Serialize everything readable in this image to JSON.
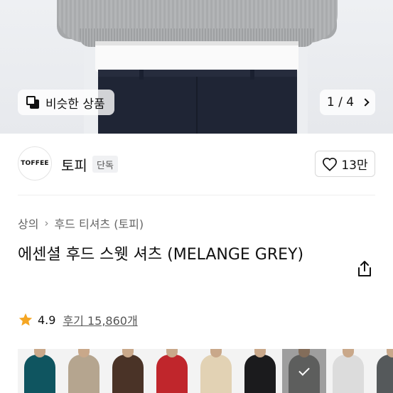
{
  "gallery": {
    "similar_label": "비슷한 상품",
    "page_current": "1",
    "page_sep": "/",
    "page_total": "4"
  },
  "brand": {
    "logo_text": "TOFFEE",
    "name": "토피",
    "badge": "단독"
  },
  "like": {
    "count": "13만"
  },
  "breadcrumb": {
    "items": [
      "상의",
      "후드 티셔츠 (토피)"
    ]
  },
  "product": {
    "title": "에센셜 후드 스웻 셔츠 (MELANGE GREY)"
  },
  "rating": {
    "score": "4.9",
    "reviews_label": "후기 15,860개"
  },
  "colors": {
    "swatches": [
      {
        "name": "teal-hoodie",
        "color": "#0f5560"
      },
      {
        "name": "beige-hoodie",
        "color": "#b5a58f"
      },
      {
        "name": "brown-hoodie",
        "color": "#4a3327"
      },
      {
        "name": "red-hoodie",
        "color": "#c0262c"
      },
      {
        "name": "cream-hoodie",
        "color": "#e2d2b4"
      },
      {
        "name": "black-hoodie",
        "color": "#1b1b1d"
      },
      {
        "name": "melange-grey-hoodie",
        "color": "#8f9190",
        "selected": true
      },
      {
        "name": "light-grey-hoodie",
        "color": "#dcdcdc"
      },
      {
        "name": "charcoal-hoodie",
        "color": "#55595b"
      }
    ]
  },
  "accent": {
    "star": "#f5a623"
  }
}
